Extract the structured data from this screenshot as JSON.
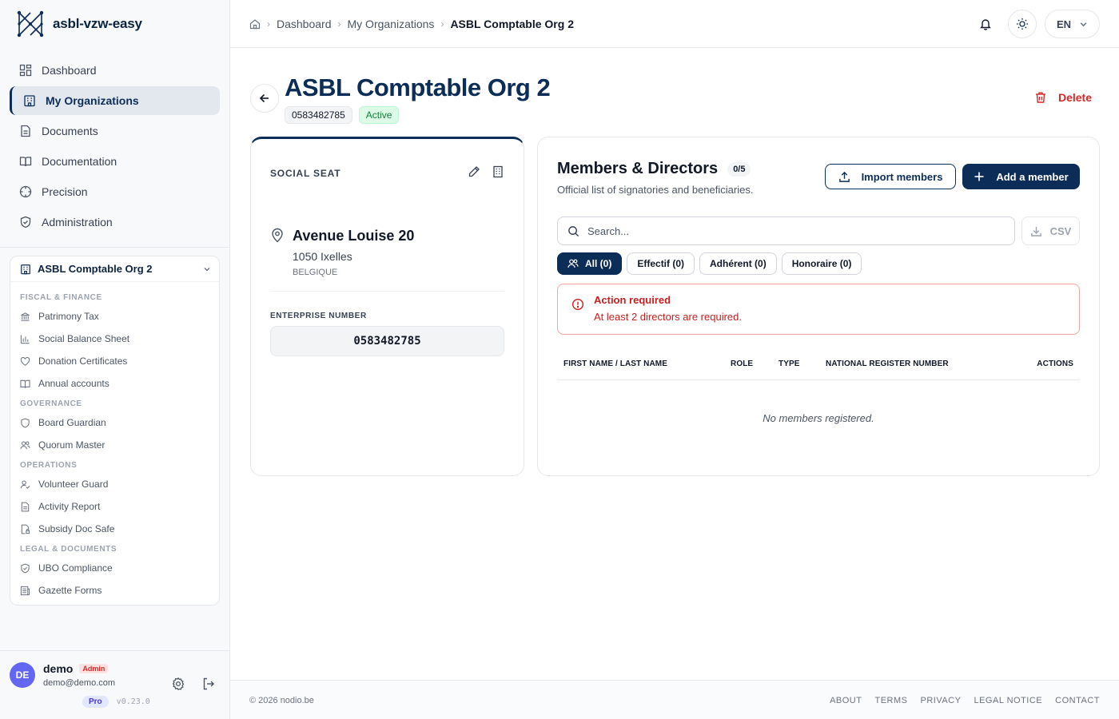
{
  "brand": {
    "name": "asbl-vzw-easy"
  },
  "sidebar": {
    "nav": [
      {
        "label": "Dashboard",
        "icon": "dashboard-icon"
      },
      {
        "label": "My Organizations",
        "icon": "building-icon"
      },
      {
        "label": "Documents",
        "icon": "document-icon"
      },
      {
        "label": "Documentation",
        "icon": "book-icon"
      },
      {
        "label": "Precision",
        "icon": "target-icon"
      },
      {
        "label": "Administration",
        "icon": "shield-icon"
      }
    ],
    "org": {
      "name": "ASBL Comptable Org 2",
      "sections": [
        {
          "title": "FISCAL & FINANCE",
          "items": [
            "Patrimony Tax",
            "Social Balance Sheet",
            "Donation Certificates",
            "Annual accounts"
          ]
        },
        {
          "title": "GOVERNANCE",
          "items": [
            "Board Guardian",
            "Quorum Master"
          ]
        },
        {
          "title": "OPERATIONS",
          "items": [
            "Volunteer Guard",
            "Activity Report",
            "Subsidy Doc Safe"
          ]
        },
        {
          "title": "LEGAL & DOCUMENTS",
          "items": [
            "UBO Compliance",
            "Gazette Forms"
          ]
        }
      ]
    },
    "user": {
      "initials": "DE",
      "name": "demo",
      "role": "Admin",
      "email": "demo@demo.com",
      "plan": "Pro",
      "version": "v0.23.0"
    }
  },
  "header": {
    "breadcrumb": [
      "Dashboard",
      "My Organizations",
      "ASBL Comptable Org 2"
    ],
    "language": "EN"
  },
  "page": {
    "title": "ASBL Comptable Org 2",
    "enterprise_tag": "0583482785",
    "status": "Active",
    "delete_label": "Delete"
  },
  "seat": {
    "label": "SOCIAL SEAT",
    "street": "Avenue Louise 20",
    "city": "1050 Ixelles",
    "country": "BELGIQUE",
    "enterprise_label": "ENTERPRISE NUMBER",
    "enterprise_number": "0583482785"
  },
  "members": {
    "title": "Members & Directors",
    "count": "0/5",
    "subtitle": "Official list of signatories and beneficiaries.",
    "import_label": "Import members",
    "add_label": "Add a member",
    "search_placeholder": "Search...",
    "csv_label": "CSV",
    "filters": [
      "All (0)",
      "Effectif (0)",
      "Adhérent (0)",
      "Honoraire (0)"
    ],
    "alert_title": "Action required",
    "alert_text": "At least 2 directors are required.",
    "columns": [
      "FIRST NAME / LAST NAME",
      "ROLE",
      "TYPE",
      "NATIONAL REGISTER NUMBER",
      "ACTIONS"
    ],
    "empty": "No members registered."
  },
  "footer": {
    "copyright": "© 2026 nodio.be",
    "links": [
      "ABOUT",
      "TERMS",
      "PRIVACY",
      "LEGAL NOTICE",
      "CONTACT"
    ]
  },
  "colors": {
    "primary": "#0c2d57",
    "danger": "#dc2626",
    "success": "#15803d",
    "avatar": "#6366f1"
  }
}
